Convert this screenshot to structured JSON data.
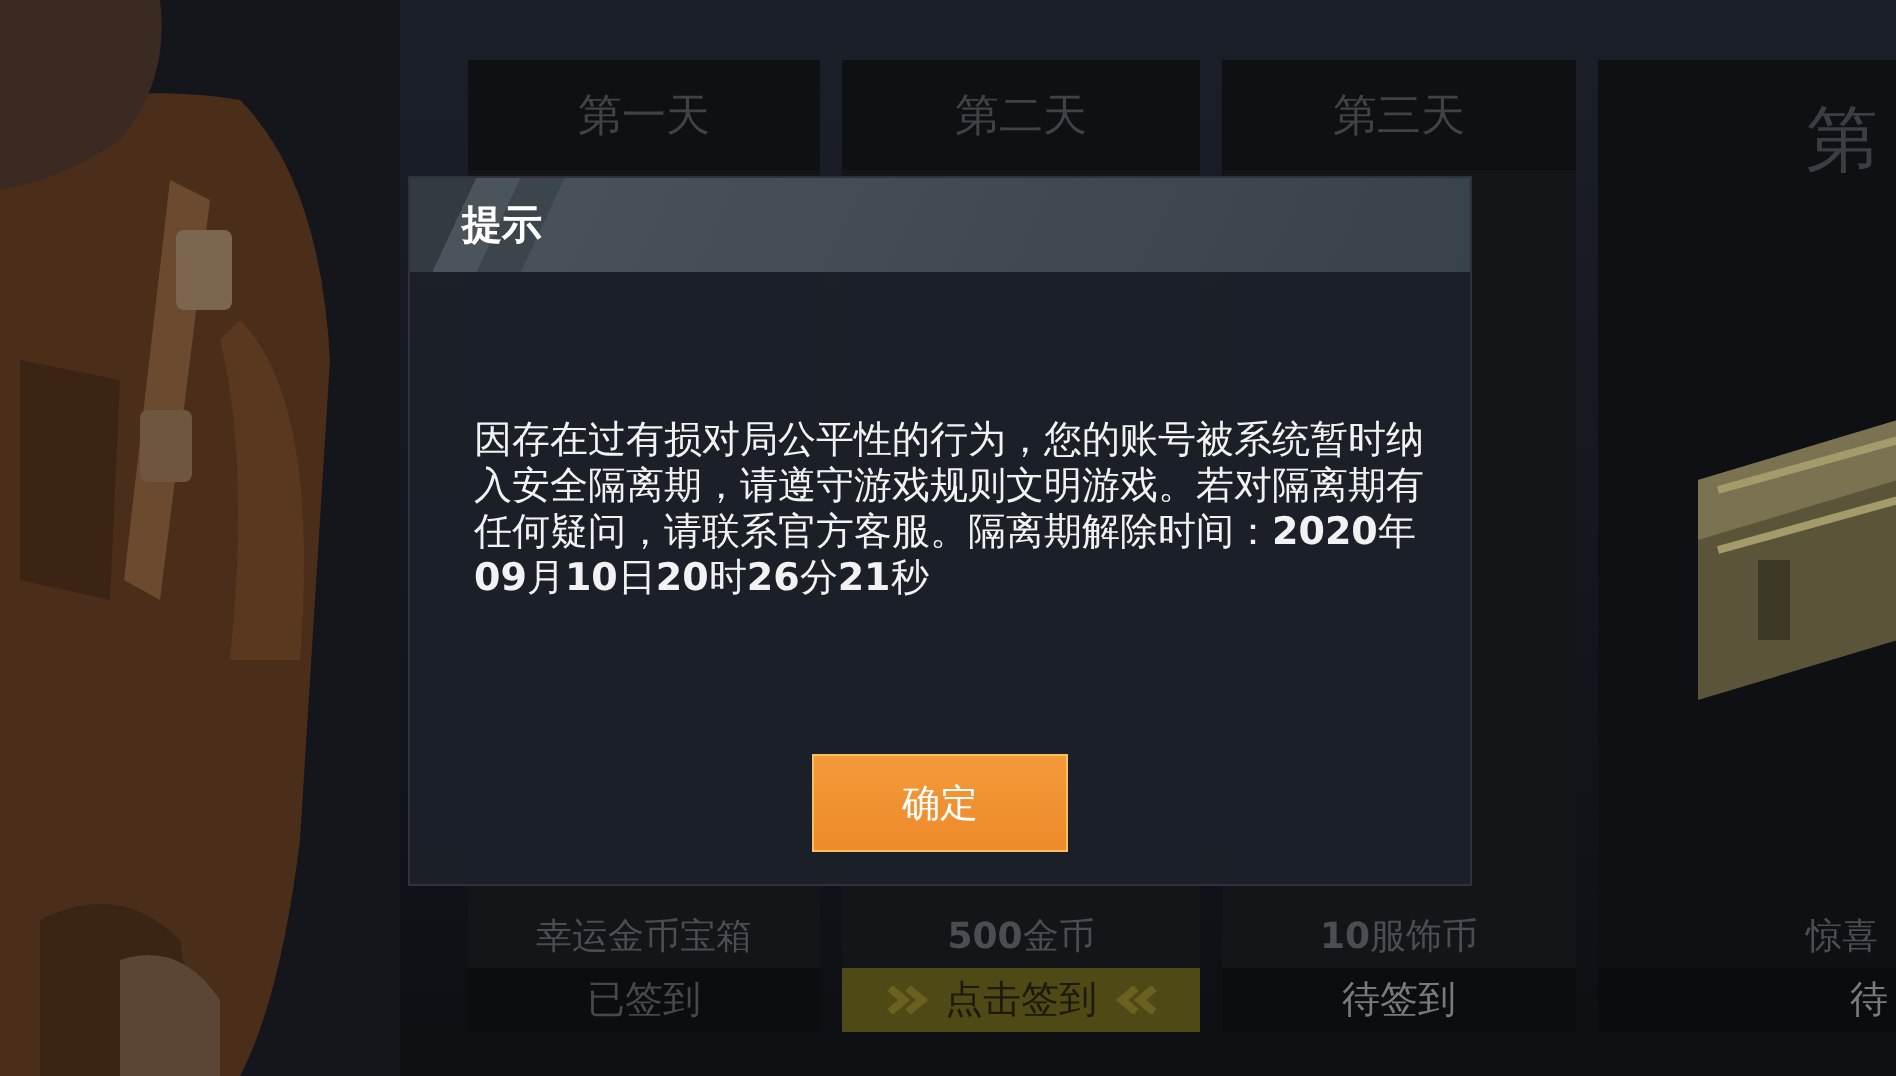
{
  "days": [
    {
      "label": "第一天",
      "reward": "幸运金币宝箱",
      "status": "已签到",
      "kind": "signed"
    },
    {
      "label": "第二天",
      "reward": "**500**金币",
      "status": "点击签到",
      "kind": "today"
    },
    {
      "label": "第三天",
      "reward": "**10**服饰币",
      "status": "待签到",
      "kind": "pending"
    },
    {
      "label": "第",
      "reward": "惊喜",
      "status": "待",
      "kind": "pending"
    }
  ],
  "dialog": {
    "title": "提示",
    "message": "因存在过有损对局公平性的行为，您的账号被系统暂时纳入安全隔离期，请遵守游戏规则文明游戏。若对隔离期有任何疑问，请联系官方客服。隔离期解除时间：**2020**年**09**月**10**日**20**时**26**分**21**秒",
    "confirm_button": "确定"
  }
}
